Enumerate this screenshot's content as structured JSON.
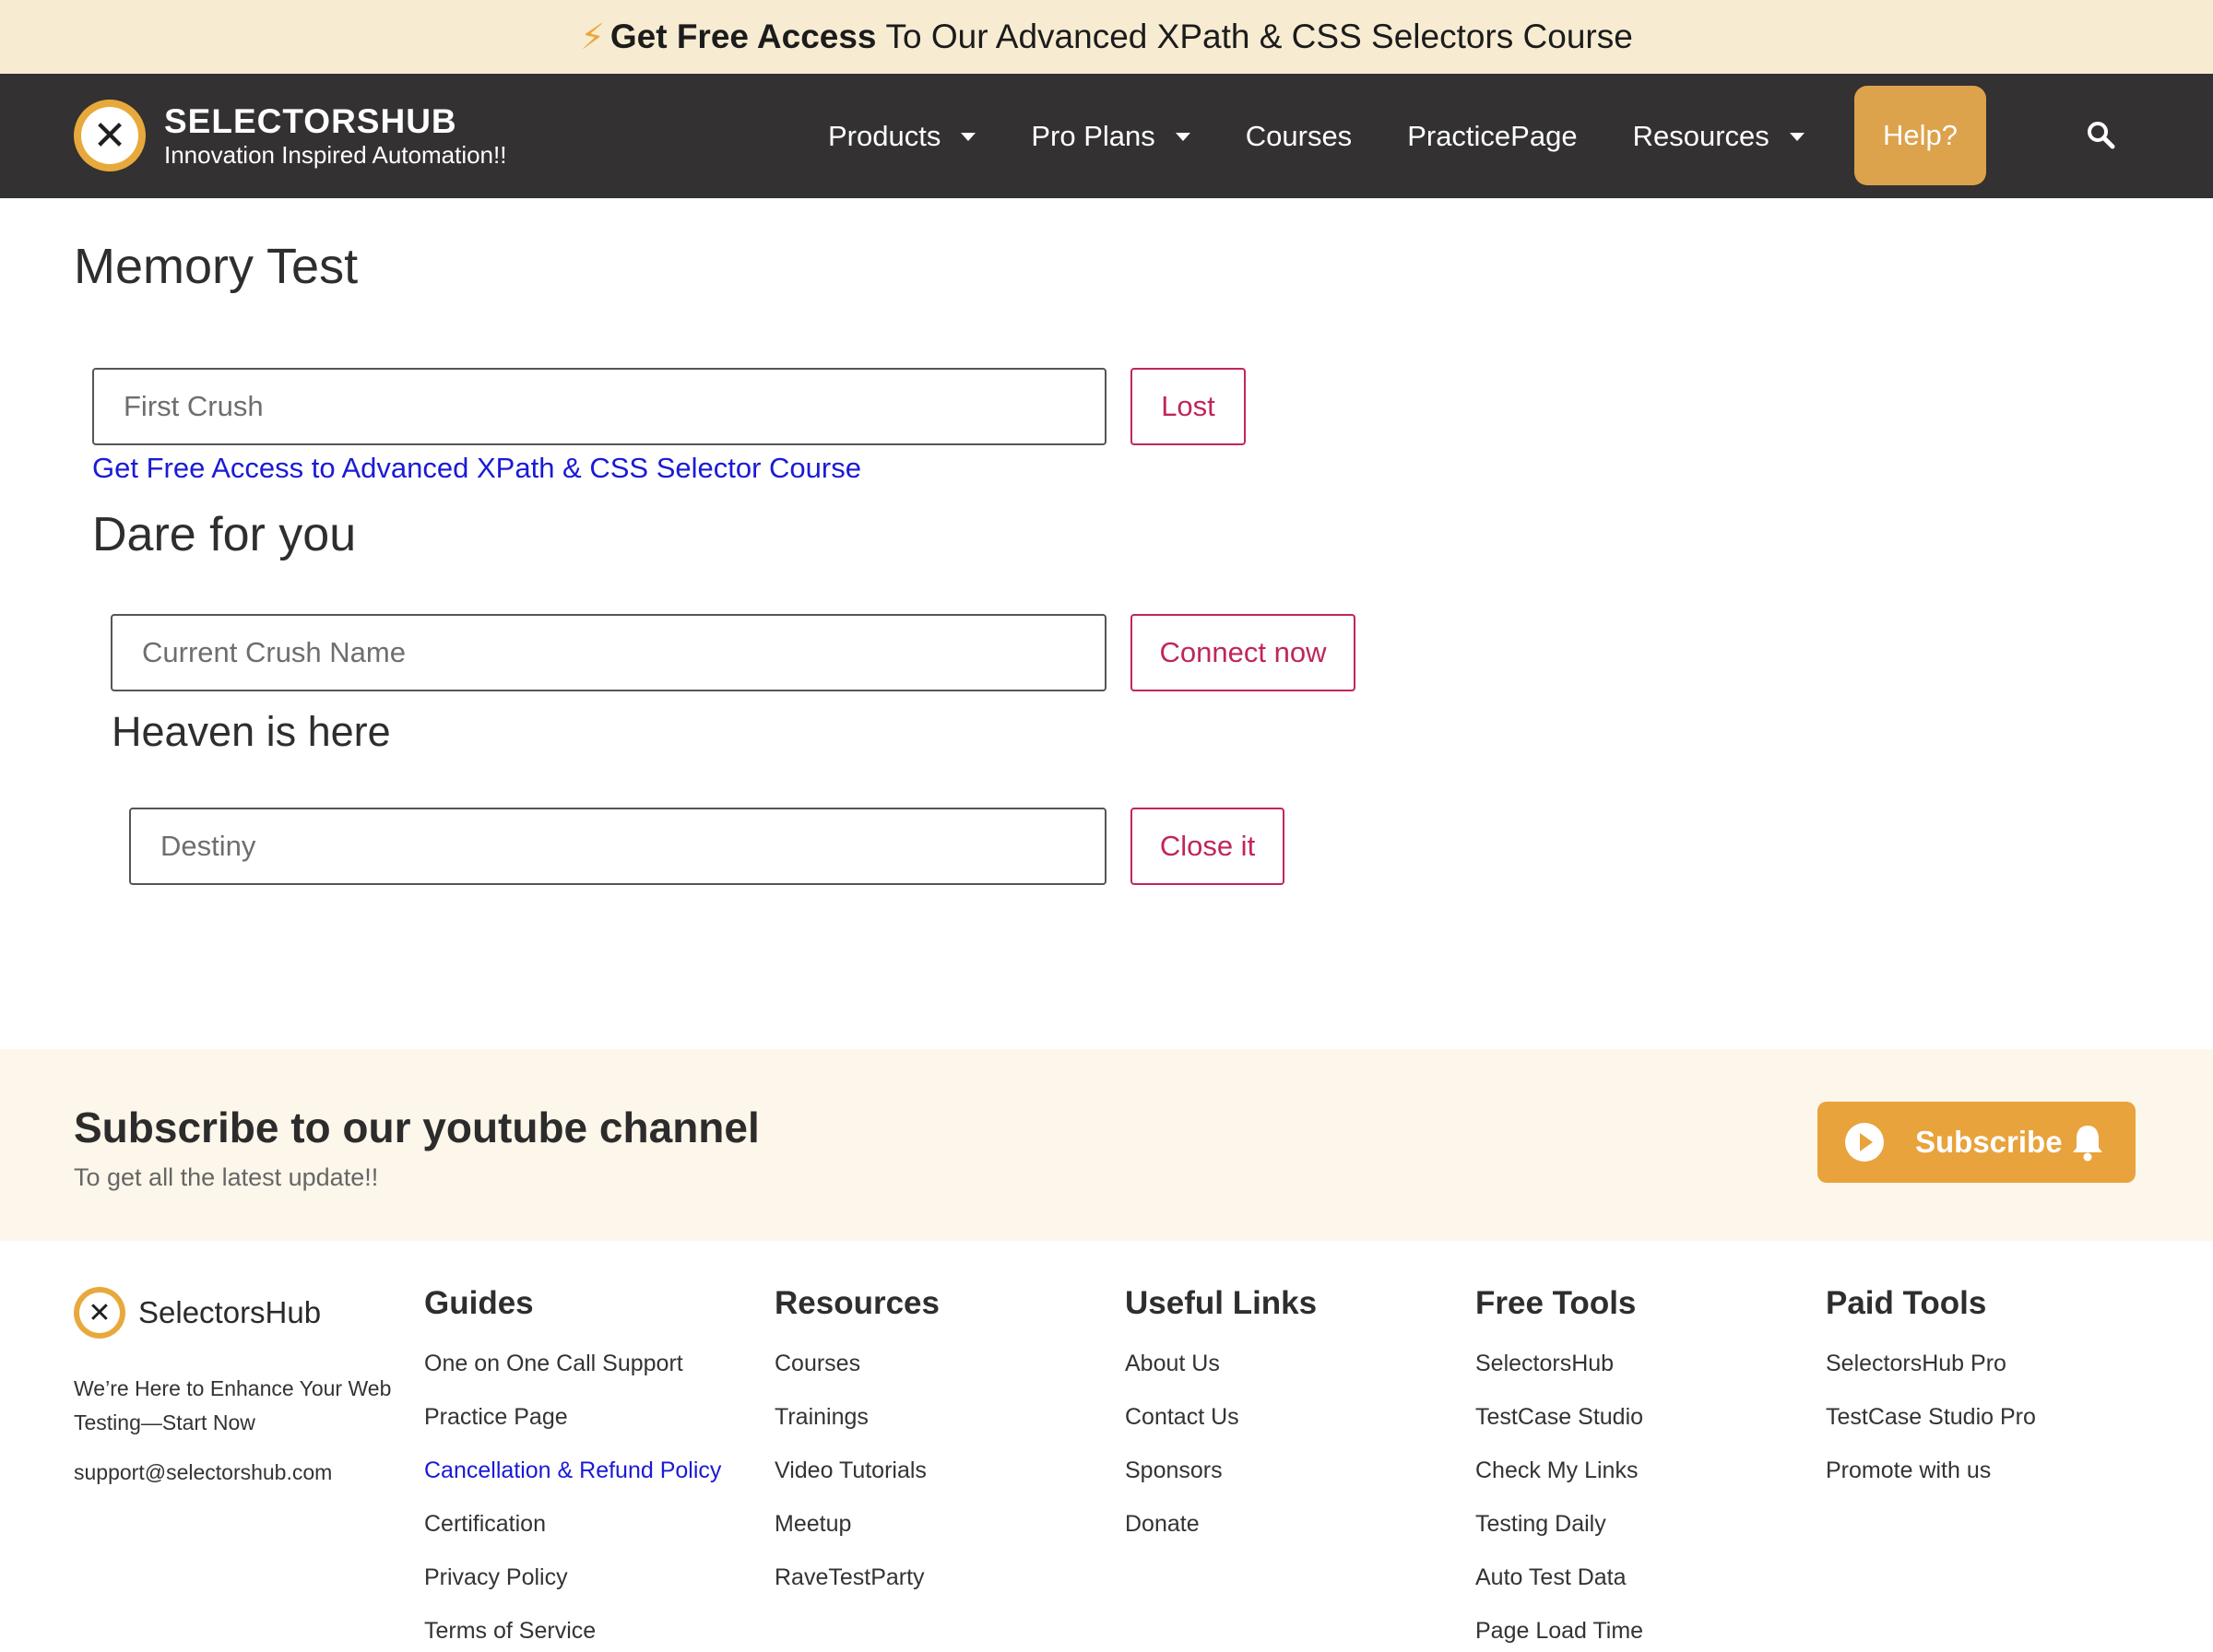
{
  "promo": {
    "bold": "Get Free Access",
    "rest": "To Our Advanced XPath & CSS Selectors Course"
  },
  "brand": {
    "name": "SELECTORSHUB",
    "tagline": "Innovation Inspired Automation!!"
  },
  "nav": {
    "items": [
      {
        "label": "Products",
        "dropdown": true
      },
      {
        "label": "Pro Plans",
        "dropdown": true
      },
      {
        "label": "Courses",
        "dropdown": false
      },
      {
        "label": "PracticePage",
        "dropdown": false
      },
      {
        "label": "Resources",
        "dropdown": true
      }
    ],
    "help": "Help?"
  },
  "page": {
    "title": "Memory Test",
    "first_placeholder": "First Crush",
    "first_button": "Lost",
    "course_link": "Get Free Access to Advanced XPath & CSS Selector Course",
    "dare_heading": "Dare for you",
    "current_placeholder": "Current Crush Name",
    "current_button": "Connect now",
    "heaven_heading": "Heaven is here",
    "destiny_placeholder": "Destiny",
    "destiny_button": "Close it"
  },
  "subscribe": {
    "title": "Subscribe to our youtube channel",
    "text": "To get all the latest update!!",
    "button": "Subscribe"
  },
  "footer": {
    "brand": "SelectorsHub",
    "description": "We’re Here to Enhance Your Web Testing—Start Now",
    "email": "support@selectorshub.com",
    "columns": [
      {
        "title": "Guides",
        "links": [
          "One on One Call Support",
          "Practice Page",
          "Cancellation & Refund Policy",
          "Certification",
          "Privacy Policy",
          "Terms of Service"
        ]
      },
      {
        "title": "Resources",
        "links": [
          "Courses",
          "Trainings",
          "Video Tutorials",
          "Meetup",
          "RaveTestParty"
        ]
      },
      {
        "title": "Useful Links",
        "links": [
          "About Us",
          "Contact Us",
          "Sponsors",
          "Donate"
        ]
      },
      {
        "title": "Free Tools",
        "links": [
          "SelectorsHub",
          "TestCase Studio",
          "Check My Links",
          "Testing Daily",
          "Auto Test Data",
          "Page Load Time"
        ]
      },
      {
        "title": "Paid Tools",
        "links": [
          "SelectorsHub Pro",
          "TestCase Studio Pro",
          "Promote with us"
        ]
      }
    ]
  },
  "colors": {
    "accent": "#e8a93c",
    "nav_bg": "#333131",
    "button_border": "#c0265a",
    "link": "#1a1ad6"
  },
  "icons": {
    "search": "search-icon",
    "bolt": "lightning-icon",
    "play": "play-icon",
    "bell": "bell-icon"
  }
}
